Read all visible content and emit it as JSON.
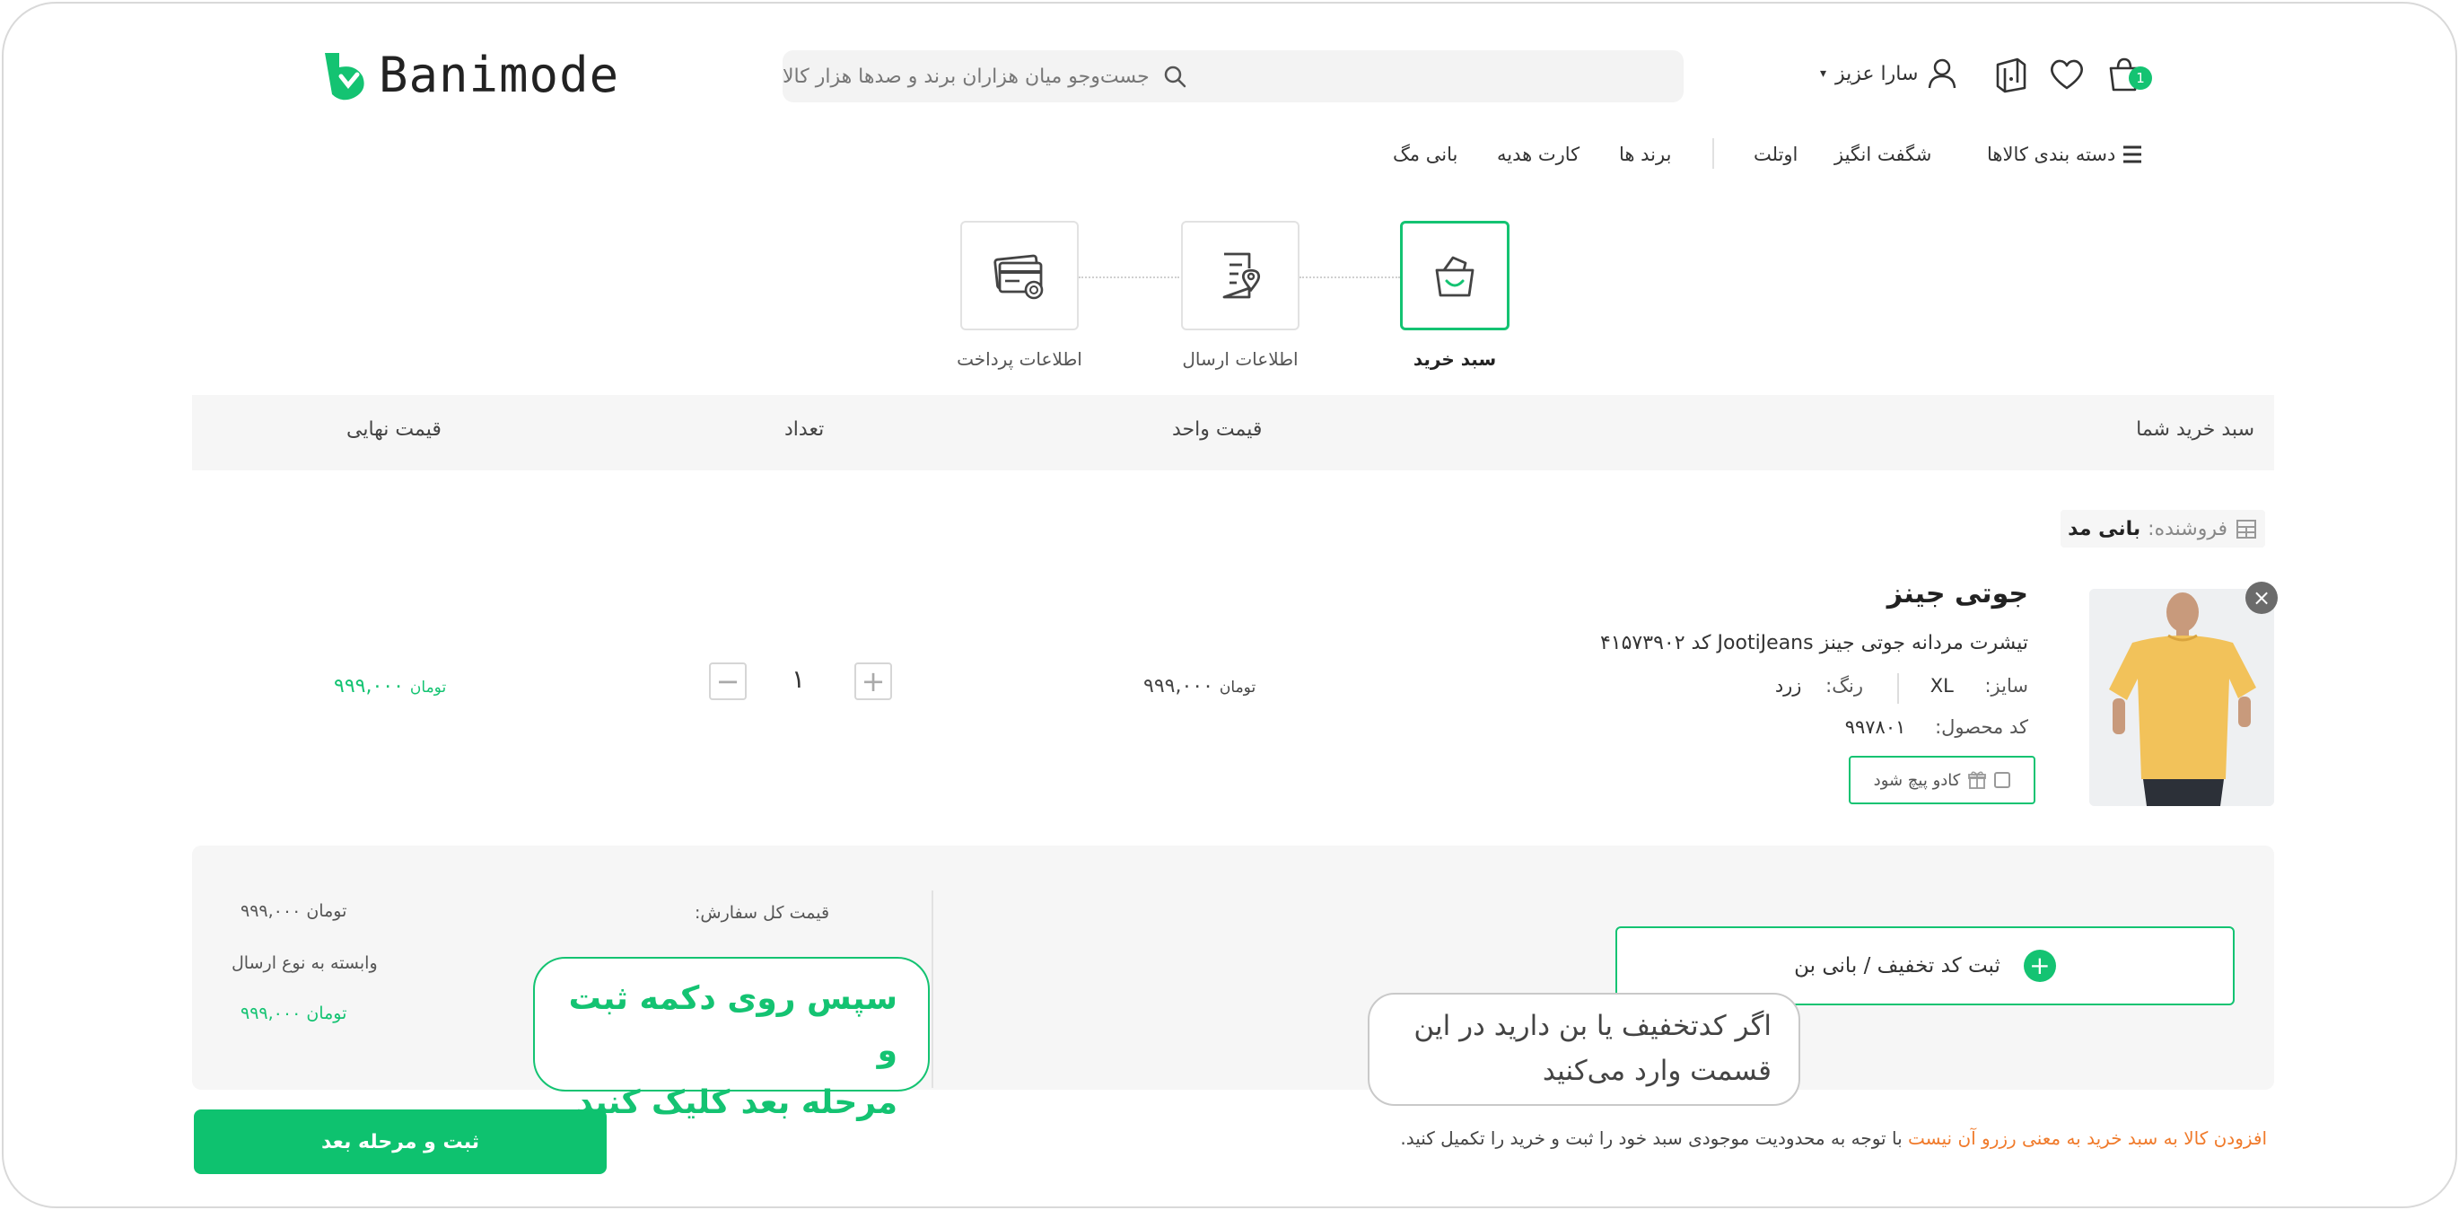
{
  "brand": {
    "name": "Banimode",
    "accent": "#14c372",
    "warning": "#f07a2a"
  },
  "header": {
    "search_placeholder": "جست‌وجو میان هزاران برند و صدها هزار کالا",
    "user_name": "سارا عزیز",
    "cart_count": "1",
    "icons": [
      "cart-icon",
      "heart-icon",
      "box-icon",
      "user-icon",
      "search-icon"
    ]
  },
  "nav": {
    "categories": "دسته بندی کالاها",
    "items": [
      "شگفت انگیز",
      "اوتلت",
      "برند ها",
      "کارت هدیه",
      "بانی مگ"
    ]
  },
  "steps": [
    {
      "label": "سبد خرید",
      "active": true
    },
    {
      "label": "اطلاعات ارسال",
      "active": false
    },
    {
      "label": "اطلاعات پرداخت",
      "active": false
    }
  ],
  "table_header": {
    "cart": "سبد خرید شما",
    "unit_price": "قیمت واحد",
    "quantity": "تعداد",
    "final_price": "قیمت نهایی"
  },
  "seller": {
    "label": "فروشنده:",
    "name": "بانی مد"
  },
  "product": {
    "brand": "جوتی جینز",
    "title": "تیشرت مردانه جوتی جینز JootiJeans کد ۴۱۵۷۳۹۰۲",
    "size_label": "سایز:",
    "size": "XL",
    "color_label": "رنگ:",
    "color": "زرد",
    "code_label": "کد محصول:",
    "code": "۹۹۷۸۰۱",
    "gift_wrap": "کادو پیچ شود",
    "unit_price": "۹۹۹,۰۰۰",
    "currency": "تومان",
    "quantity": "۱",
    "final_price": "۹۹۹,۰۰۰"
  },
  "summary": {
    "total_label": "قیمت کل سفارش:",
    "total_value": "۹۹۹,۰۰۰",
    "currency": "تومان",
    "shipping_note": "وابسته به نوع ارسال",
    "payable_value": "۹۹۹,۰۰۰",
    "discount_button": "ثبت کد تخفیف / بانی بن"
  },
  "tooltips": {
    "green_line1": "سپس روی دکمه ثبت و",
    "green_line2": "مرحله بعد کلیک کنید",
    "gray_line1": "اگر کدتخفیف یا بن دارید در این",
    "gray_line2": "قسمت وارد می‌کنید"
  },
  "footer": {
    "next_button": "ثبت و مرحله بعد",
    "note_warning": "افزودن کالا به سبد خرید به معنی رزرو آن نیست",
    "note_rest": " با توجه به محدودیت موجودی سبد خود را ثبت و خرید را تکمیل کنید."
  }
}
